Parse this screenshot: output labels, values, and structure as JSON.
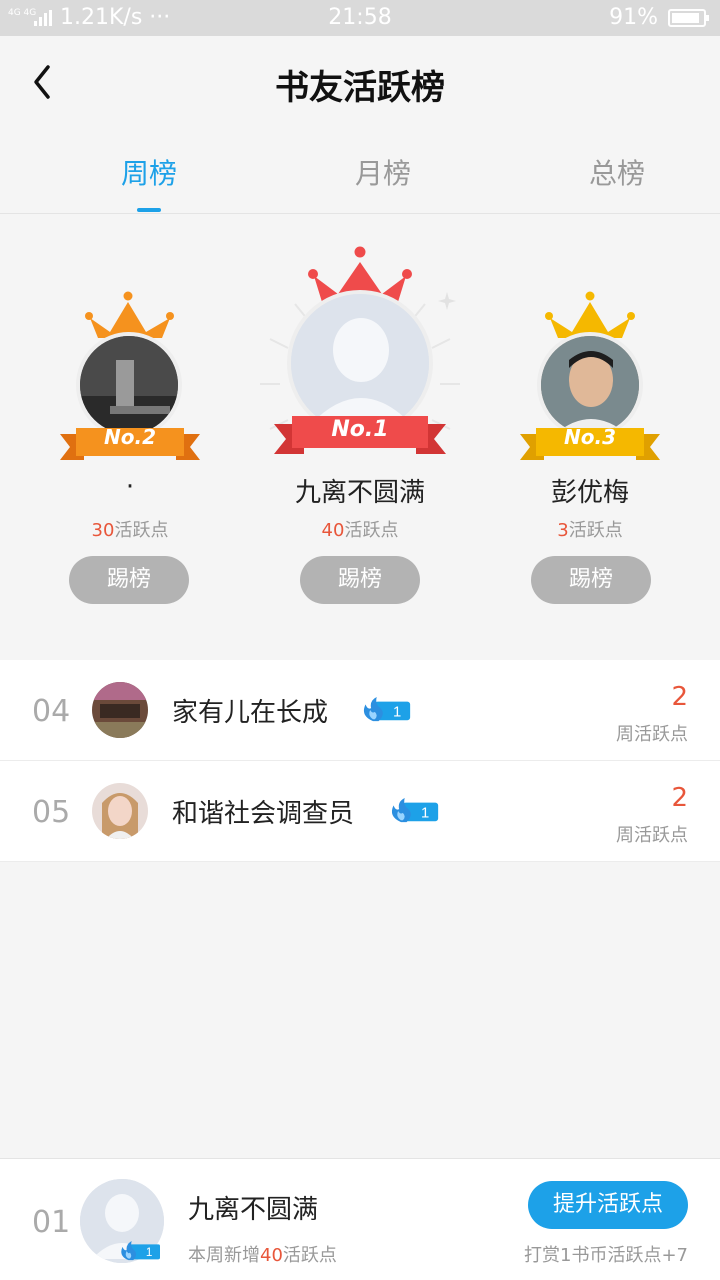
{
  "status": {
    "speed": "1.21K/s ···",
    "time": "21:58",
    "battery_pct": "91%",
    "battery_level": 0.91,
    "network": "4G 4G"
  },
  "nav": {
    "title": "书友活跃榜"
  },
  "tabs": [
    {
      "label": "周榜",
      "active": true
    },
    {
      "label": "月榜",
      "active": false
    },
    {
      "label": "总榜",
      "active": false
    }
  ],
  "podium": {
    "first": {
      "badge": "No.1",
      "name": "九离不圆满",
      "points": "40",
      "points_suffix": "活跃点",
      "action": "踢榜"
    },
    "second": {
      "badge": "No.2",
      "name": "·",
      "points": "30",
      "points_suffix": "活跃点",
      "action": "踢榜"
    },
    "third": {
      "badge": "No.3",
      "name": "彭优梅",
      "points": "3",
      "points_suffix": "活跃点",
      "action": "踢榜"
    }
  },
  "list": [
    {
      "rank": "04",
      "name": "家有儿在长成",
      "level": "1",
      "value": "2",
      "value_label": "周活跃点"
    },
    {
      "rank": "05",
      "name": "和谐社会调查员",
      "level": "1",
      "value": "2",
      "value_label": "周活跃点"
    }
  ],
  "me": {
    "rank": "01",
    "name": "九离不圆满",
    "level": "1",
    "sub_prefix": "本周新增",
    "sub_points": "40",
    "sub_suffix": "活跃点",
    "button": "提升活跃点",
    "tip": "打赏1书币活跃点+7"
  },
  "colors": {
    "accent": "#1da1e8",
    "points": "#e8563a",
    "gold": "#f5b800",
    "red": "#ef4b4b",
    "orange": "#f5921e"
  }
}
